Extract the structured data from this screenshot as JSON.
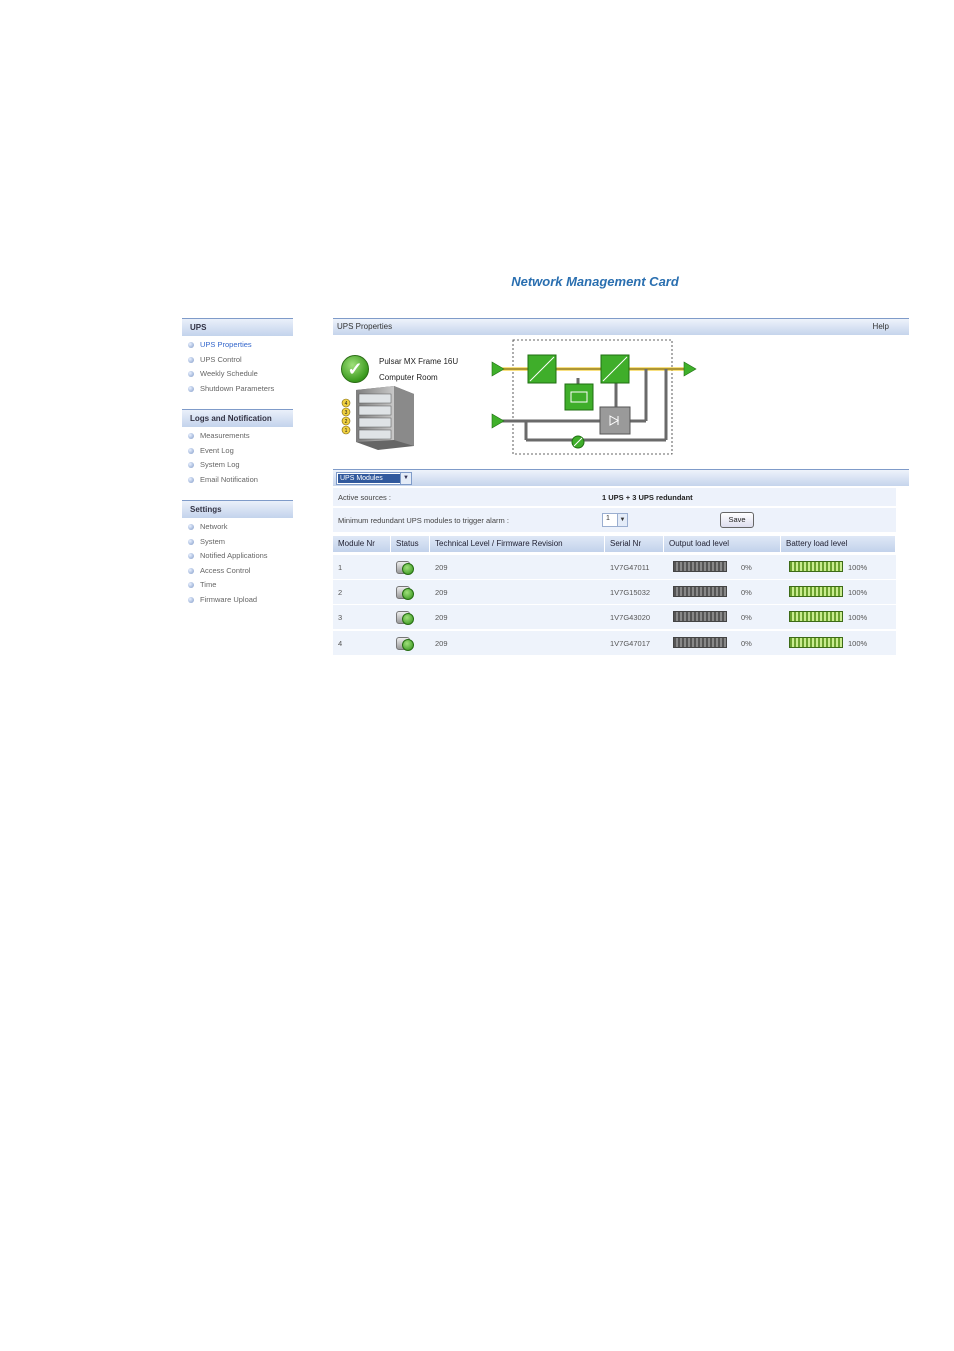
{
  "app_title": "Network Management Card",
  "sidebar": {
    "sections": [
      {
        "title": "UPS",
        "items": [
          "UPS Properties",
          "UPS Control",
          "Weekly Schedule",
          "Shutdown Parameters"
        ]
      },
      {
        "title": "Logs and Notification",
        "items": [
          "Measurements",
          "Event Log",
          "System Log",
          "Email Notification"
        ]
      },
      {
        "title": "Settings",
        "items": [
          "Network",
          "System",
          "Notified Applications",
          "Access Control",
          "Time",
          "Firmware Upload"
        ]
      }
    ],
    "active_item": "UPS Properties"
  },
  "panel": {
    "title": "UPS Properties",
    "help": "Help"
  },
  "ups": {
    "name": "Pulsar MX Frame 16U",
    "location": "Computer Room",
    "rack_modules": [
      "4",
      "3",
      "2",
      "1"
    ]
  },
  "modules_section": {
    "dropdown_selected": "UPS Modules",
    "active_sources_label": "Active sources :",
    "active_sources_value": "1 UPS + 3 UPS redundant",
    "min_redundant_label": "Minimum redundant UPS modules to trigger alarm :",
    "min_redundant_value": "1",
    "save_label": "Save"
  },
  "table": {
    "headers": [
      "Module Nr",
      "Status",
      "Technical Level / Firmware Revision",
      "Serial Nr",
      "Output load level",
      "Battery load level"
    ],
    "rows": [
      {
        "module": "1",
        "tech": "209",
        "serial": "1V7G47011",
        "output": "0%",
        "battery": "100%"
      },
      {
        "module": "2",
        "tech": "209",
        "serial": "1V7G15032",
        "output": "0%",
        "battery": "100%"
      },
      {
        "module": "3",
        "tech": "209",
        "serial": "1V7G43020",
        "output": "0%",
        "battery": "100%"
      },
      {
        "module": "4",
        "tech": "209",
        "serial": "1V7G47017",
        "output": "0%",
        "battery": "100%"
      }
    ]
  },
  "colors": {
    "accent": "#2a6fb0",
    "header_band": "#c5d4ec",
    "row_bg": "#eef3fb",
    "ok_green": "#3a9a1e"
  }
}
